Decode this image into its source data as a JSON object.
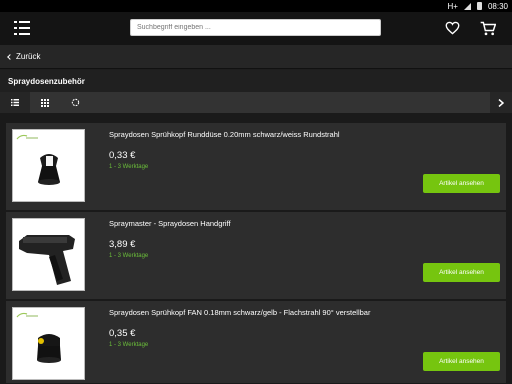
{
  "status_bar": {
    "network": "H+",
    "time": "08:30"
  },
  "header": {
    "search": {
      "placeholder": "Suchbegriff eingeben ..."
    },
    "icons": [
      "menu-icon",
      "heart-icon",
      "cart-icon"
    ]
  },
  "nav": {
    "back_label": "Zurück"
  },
  "category": {
    "title": "Spraydosenzubehör"
  },
  "view_bar": {
    "icons": [
      "list-view-icon",
      "grid-view-icon",
      "refresh-icon",
      "chevron-right-icon"
    ]
  },
  "products": [
    {
      "title": "Spraydosen Sprühkopf Runddüse 0.20mm schwarz/weiss Rundstrahl",
      "price": "0,33 €",
      "delivery": "1 - 3 Werktage",
      "button": "Artikel ansehen",
      "image": "spray-cap-white-stripe-icon"
    },
    {
      "title": "Spraymaster - Spraydosen Handgriff",
      "price": "3,89 €",
      "delivery": "1 - 3 Werktage",
      "button": "Artikel ansehen",
      "image": "spray-gun-handle-icon"
    },
    {
      "title": "Spraydosen Sprühkopf FAN 0.18mm schwarz/gelb - Flachstrahl 90° verstellbar",
      "price": "0,35 €",
      "delivery": "1 - 3 Werktage",
      "button": "Artikel ansehen",
      "image": "spray-cap-yellow-dot-icon"
    }
  ],
  "colors": {
    "accent": "#76c50f",
    "delivery_text": "#6bbf3a",
    "background": "#1a1a1a",
    "card": "#2d2d2d"
  }
}
